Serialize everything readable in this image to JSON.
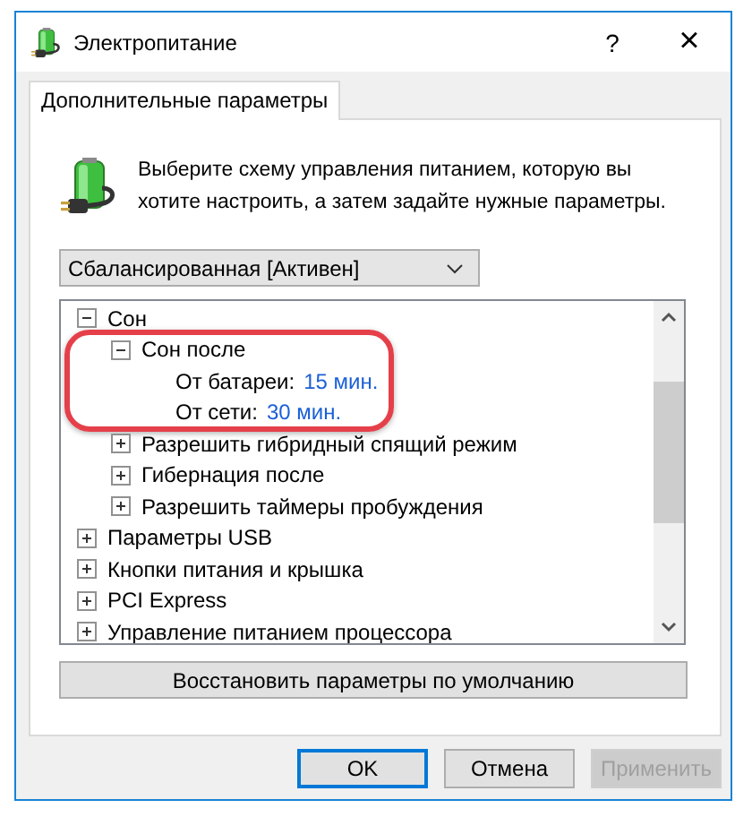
{
  "window": {
    "title": "Электропитание",
    "help": "?",
    "close": "×"
  },
  "tabs": [
    {
      "label": "Дополнительные параметры",
      "selected": true
    }
  ],
  "description": "Выберите схему управления питанием, которую вы хотите настроить, а затем задайте нужные параметры.",
  "plan_dropdown": {
    "value": "Сбалансированная [Активен]"
  },
  "settings_tree": [
    {
      "label": "Сон",
      "expanded": true,
      "children": [
        {
          "label": "Сон после",
          "expanded": true,
          "highlighted": true,
          "children": [
            {
              "label": "От батареи:",
              "value": "15 мин."
            },
            {
              "label": "От сети:",
              "value": "30 мин."
            }
          ]
        },
        {
          "label": "Разрешить гибридный спящий режим",
          "expanded": false
        },
        {
          "label": "Гибернация после",
          "expanded": false
        },
        {
          "label": "Разрешить таймеры пробуждения",
          "expanded": false
        }
      ]
    },
    {
      "label": "Параметры USB",
      "expanded": false
    },
    {
      "label": "Кнопки питания и крышка",
      "expanded": false
    },
    {
      "label": "PCI Express",
      "expanded": false
    },
    {
      "label": "Управление питанием процессора",
      "expanded": false
    }
  ],
  "restore_button": "Восстановить параметры по умолчанию",
  "buttons": [
    {
      "label": "OK",
      "kind": "default",
      "disabled": false
    },
    {
      "label": "Отмена",
      "kind": "normal",
      "disabled": false
    },
    {
      "label": "Применить",
      "kind": "normal",
      "disabled": true
    }
  ]
}
